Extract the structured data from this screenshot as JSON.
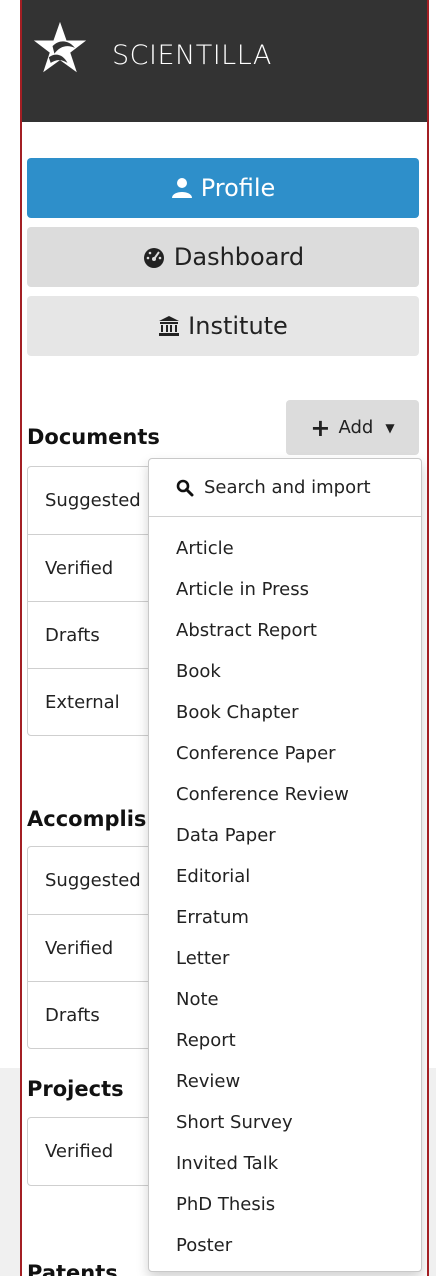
{
  "app": {
    "brand": "SCIENTILLA"
  },
  "nav": {
    "profile": "Profile",
    "dashboard": "Dashboard",
    "institute": "Institute"
  },
  "documents": {
    "title": "Documents",
    "add_label": "Add",
    "items": [
      "Suggested",
      "Verified",
      "Drafts",
      "External"
    ]
  },
  "accomplishments": {
    "title": "Accomplis",
    "items": [
      "Suggested",
      "Verified",
      "Drafts"
    ]
  },
  "projects": {
    "title": "Projects",
    "items": [
      "Verified"
    ]
  },
  "patents": {
    "title": "Patents"
  },
  "add_menu": {
    "search_label": "Search and import",
    "items": [
      "Article",
      "Article in Press",
      "Abstract Report",
      "Book",
      "Book Chapter",
      "Conference Paper",
      "Conference Review",
      "Data Paper",
      "Editorial",
      "Erratum",
      "Letter",
      "Note",
      "Report",
      "Review",
      "Short Survey",
      "Invited Talk",
      "PhD Thesis",
      "Poster"
    ]
  },
  "colors": {
    "primary": "#2e8fca",
    "topbar": "#333333",
    "border_accent": "#a31f24"
  },
  "icons": {
    "profile": "user-icon",
    "dashboard": "tachometer-icon",
    "institute": "institution-icon",
    "search": "search-icon",
    "add": "plus-icon",
    "caret": "caret-down-icon"
  }
}
